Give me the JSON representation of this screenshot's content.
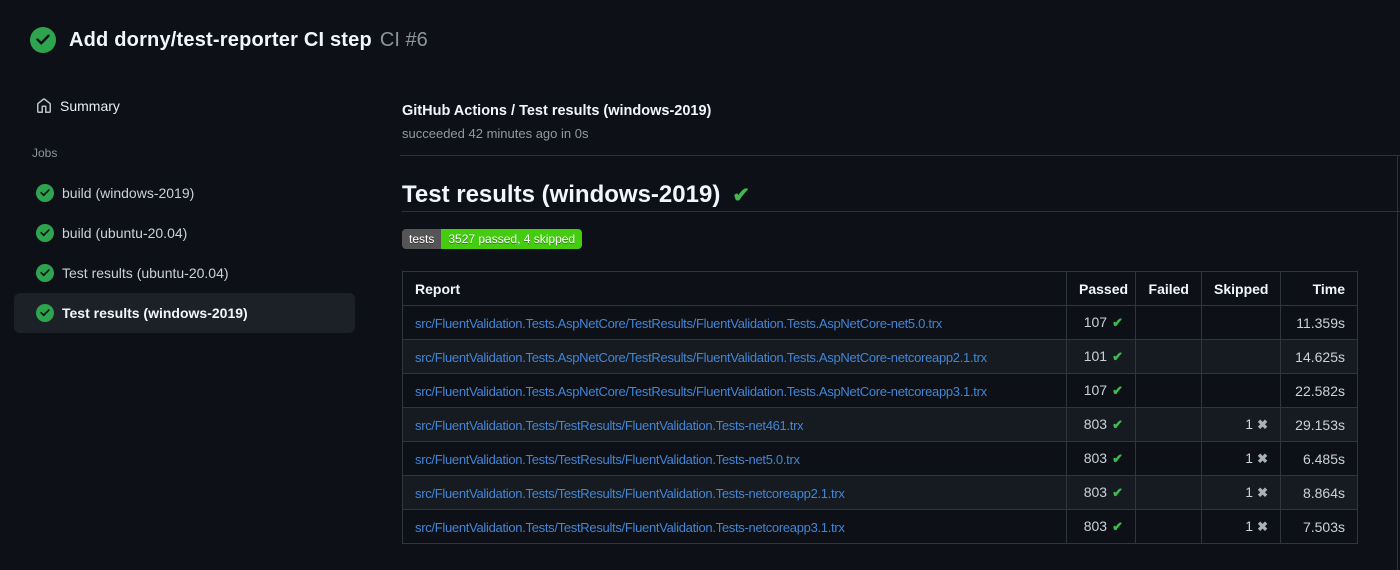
{
  "colors": {
    "page_bg": "#0d1117",
    "status_green": "#2ea44f",
    "pass_check_green": "#3fb950",
    "link_blue": "#4285d6",
    "selected_item_bg": "#1c2128",
    "badge_label_bg": "#555555",
    "badge_value_bg": "#44cc11"
  },
  "header": {
    "status_icon": "check-circle-icon",
    "title": "Add dorny/test-reporter CI step",
    "run_number": "CI #6"
  },
  "sidebar": {
    "summary_label": "Summary",
    "jobs_section_label": "Jobs",
    "jobs": [
      {
        "label": "build (windows-2019)",
        "status": "success",
        "selected": false
      },
      {
        "label": "build (ubuntu-20.04)",
        "status": "success",
        "selected": false
      },
      {
        "label": "Test results (ubuntu-20.04)",
        "status": "success",
        "selected": false
      },
      {
        "label": "Test results (windows-2019)",
        "status": "success",
        "selected": true
      }
    ]
  },
  "main": {
    "run_title": "GitHub Actions / Test results (windows-2019)",
    "run_status": "succeeded 42 minutes ago in 0s",
    "section_title": "Test results (windows-2019)",
    "section_check": "✔",
    "badge": {
      "label": "tests",
      "value": "3527 passed, 4 skipped"
    },
    "table": {
      "headers": {
        "report": "Report",
        "passed": "Passed",
        "failed": "Failed",
        "skipped": "Skipped",
        "time": "Time"
      },
      "pass_icon": "✔",
      "skip_icon": "✖",
      "rows": [
        {
          "report": "src/FluentValidation.Tests.AspNetCore/TestResults/FluentValidation.Tests.AspNetCore-net5.0.trx",
          "passed": "107",
          "failed": "",
          "skipped": "",
          "time": "11.359s"
        },
        {
          "report": "src/FluentValidation.Tests.AspNetCore/TestResults/FluentValidation.Tests.AspNetCore-netcoreapp2.1.trx",
          "passed": "101",
          "failed": "",
          "skipped": "",
          "time": "14.625s"
        },
        {
          "report": "src/FluentValidation.Tests.AspNetCore/TestResults/FluentValidation.Tests.AspNetCore-netcoreapp3.1.trx",
          "passed": "107",
          "failed": "",
          "skipped": "",
          "time": "22.582s"
        },
        {
          "report": "src/FluentValidation.Tests/TestResults/FluentValidation.Tests-net461.trx",
          "passed": "803",
          "failed": "",
          "skipped": "1",
          "time": "29.153s"
        },
        {
          "report": "src/FluentValidation.Tests/TestResults/FluentValidation.Tests-net5.0.trx",
          "passed": "803",
          "failed": "",
          "skipped": "1",
          "time": "6.485s"
        },
        {
          "report": "src/FluentValidation.Tests/TestResults/FluentValidation.Tests-netcoreapp2.1.trx",
          "passed": "803",
          "failed": "",
          "skipped": "1",
          "time": "8.864s"
        },
        {
          "report": "src/FluentValidation.Tests/TestResults/FluentValidation.Tests-netcoreapp3.1.trx",
          "passed": "803",
          "failed": "",
          "skipped": "1",
          "time": "7.503s"
        }
      ]
    }
  }
}
